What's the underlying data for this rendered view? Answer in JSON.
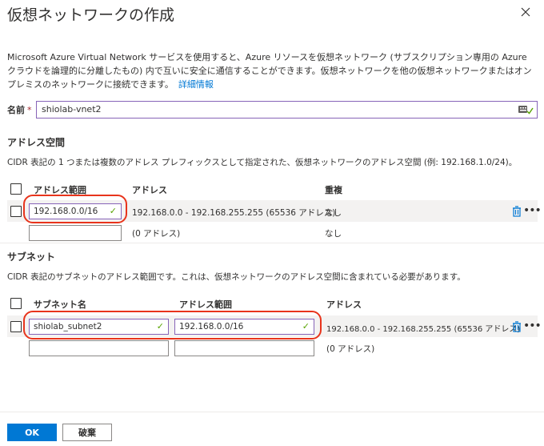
{
  "dialog": {
    "title": "仮想ネットワークの作成",
    "description": "Microsoft Azure Virtual Network サービスを使用すると、Azure リソースを仮想ネットワーク (サブスクリプション専用の Azure クラウドを論理的に分離したもの) 内で互いに安全に通信することができます。仮想ネットワークを他の仮想ネットワークまたはオンプレミスのネットワークに接続できます。",
    "learn_more": "詳細情報"
  },
  "name_field": {
    "label": "名前",
    "required_mark": "*",
    "value": "shiolab-vnet2"
  },
  "address_space": {
    "title": "アドレス空間",
    "description": "CIDR 表記の 1 つまたは複数のアドレス プレフィックスとして指定された、仮想ネットワークのアドレス空間 (例: 192.168.1.0/24)。",
    "headers": {
      "range": "アドレス範囲",
      "addresses": "アドレス",
      "overlap": "重複"
    },
    "rows": [
      {
        "range": "192.168.0.0/16",
        "addresses": "192.168.0.0 - 192.168.255.255 (65536 アドレス)",
        "overlap": "なし"
      },
      {
        "range": "",
        "addresses": "(0 アドレス)",
        "overlap": "なし"
      }
    ]
  },
  "subnet": {
    "title": "サブネット",
    "description": "CIDR 表記のサブネットのアドレス範囲です。これは、仮想ネットワークのアドレス空間に含まれている必要があります。",
    "headers": {
      "name": "サブネット名",
      "range": "アドレス範囲",
      "addresses": "アドレス"
    },
    "rows": [
      {
        "name": "shiolab_subnet2",
        "range": "192.168.0.0/16",
        "addresses": "192.168.0.0 - 192.168.255.255 (65536 アドレス)"
      },
      {
        "name": "",
        "range": "",
        "addresses": "(0 アドレス)"
      }
    ]
  },
  "footer": {
    "ok": "OK",
    "discard": "破棄"
  },
  "colors": {
    "accent": "#0078d4",
    "valid": "#57a300",
    "highlight": "#e8341c",
    "active_border": "#8764b8"
  },
  "icons": {
    "close": "close-icon",
    "check": "checkmark-icon",
    "trash": "trash-icon",
    "more": "more-icon",
    "field_helper": "field-helper-icon"
  }
}
